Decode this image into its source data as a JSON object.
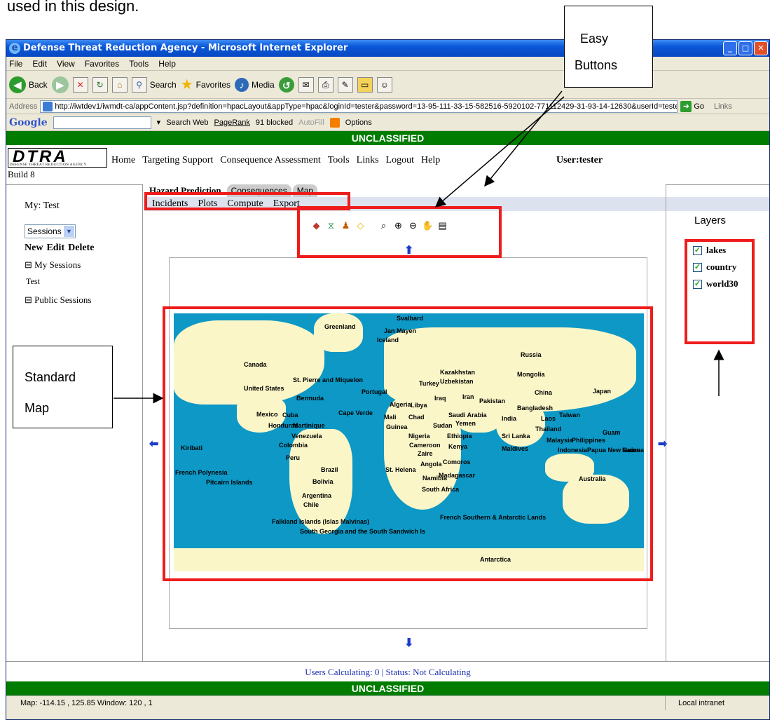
{
  "doc_caption": "used in this design.",
  "window": {
    "title": "Defense Threat Reduction Agency - Microsoft Internet Explorer",
    "controls": [
      "_",
      "□",
      "✕"
    ]
  },
  "menu": [
    "File",
    "Edit",
    "View",
    "Favorites",
    "Tools",
    "Help"
  ],
  "toolbar": {
    "back": "Back",
    "search": "Search",
    "favorites": "Favorites",
    "media": "Media"
  },
  "address": {
    "label": "Address",
    "url": "http://iwtdev1/iwmdt-ca/appContent.jsp?definition=hpacLayout&appType=hpac&loginId=tester&password=13-95-111-33-15-582516-5920102-771112429-31-93-14-12630&userId=tester",
    "go": "Go",
    "links": "Links"
  },
  "google_bar": {
    "logo": "Google",
    "search_web": "Search Web",
    "pagerank": "PageRank",
    "blocked": "91 blocked",
    "autofill": "AutoFill",
    "options": "Options"
  },
  "classification": "UNCLASSIFIED",
  "app": {
    "logo": "DTRA",
    "logo_sub": "DEFENSE THREAT REDUCTION AGENCY",
    "build": "Build 8",
    "nav": [
      "Home",
      "Targeting Support",
      "Consequence Assessment",
      "Tools",
      "Links",
      "Logout",
      "Help"
    ],
    "user": "User:tester"
  },
  "left": {
    "my_label": "My: Test",
    "select_value": "Sessions",
    "actions": [
      "New",
      "Edit",
      "Delete"
    ],
    "my_sessions": "My Sessions",
    "test_item": "Test",
    "public_sessions": "Public Sessions"
  },
  "tabs": [
    "Hazard Prediction",
    "Consequences",
    "Map"
  ],
  "subnav": [
    "Incidents",
    "Plots",
    "Compute",
    "Export"
  ],
  "map_labels": [
    "Greenland",
    "Svalbard",
    "Jan Mayen",
    "Iceland",
    "Russia",
    "Canada",
    "Kazakhstan",
    "Mongolia",
    "St. Pierre and Miquelon",
    "United States",
    "Portugal",
    "Turkey",
    "Uzbekistan",
    "China",
    "Japan",
    "Bermuda",
    "Iraq",
    "Iran",
    "Pakistan",
    "Mexico",
    "Cuba",
    "Algeria",
    "Libya",
    "Saudi Arabia",
    "India",
    "Bangladesh",
    "Laos",
    "Taiwan",
    "Honduras",
    "Martinique",
    "Cape Verde",
    "Mali",
    "Chad",
    "Sudan",
    "Yemen",
    "Thailand",
    "Guam",
    "Venezuela",
    "Guinea",
    "Nigeria",
    "Ethiopia",
    "Sri Lanka",
    "Malaysia",
    "Philippines",
    "Kiribati",
    "Colombia",
    "Cameroon",
    "Kenya",
    "Zaire",
    "Maldives",
    "Indonesia",
    "Papua New Guinea",
    "Nauru",
    "Peru",
    "Angola",
    "Comoros",
    "Brazil",
    "French Polynesia",
    "St. Helena",
    "Namibia",
    "Madagascar",
    "Australia",
    "Pitcairn Islands",
    "Bolivia",
    "South Africa",
    "Argentina",
    "Chile",
    "Falkland Islands (Islas Malvinas)",
    "French Southern & Antarctic Lands",
    "South Georgia and the South Sandwich Is",
    "Antarctica"
  ],
  "layers": {
    "title": "Layers",
    "items": [
      "lakes",
      "country",
      "world30"
    ]
  },
  "status_line": "Users Calculating: 0 | Status: Not Calculating",
  "ie_status": {
    "left": "Map: -114.15 , 125.85    Window: 120 , 1",
    "zone": "Local intranet"
  },
  "callouts": {
    "easy_1": "Easy",
    "easy_2": "Buttons",
    "std_1": "Standard",
    "std_2": "Map"
  },
  "colors": {
    "classification_bar": "#007d00",
    "ocean": "#0d98c6",
    "land": "#fbf6c8",
    "highlight": "#ee1c1c",
    "status_text": "#1a2fb0"
  }
}
